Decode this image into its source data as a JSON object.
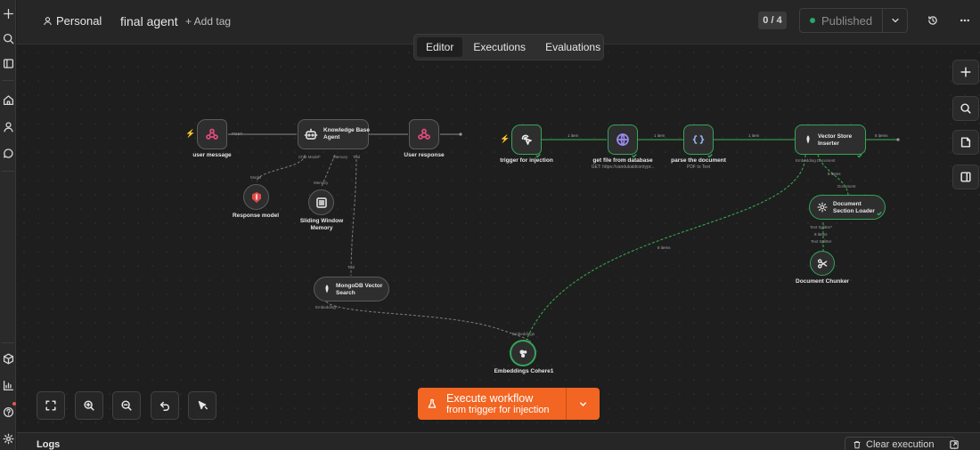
{
  "header": {
    "project_label": "Personal",
    "workflow_name": "final agent",
    "add_tag_label": "+ Add tag",
    "counter": "0 / 4",
    "status_label": "Published",
    "status_color": "#2aa765"
  },
  "tabs": [
    {
      "label": "Editor",
      "active": true
    },
    {
      "label": "Executions",
      "active": false
    },
    {
      "label": "Evaluations",
      "active": false
    }
  ],
  "nodes": {
    "user_message": {
      "label": "user message"
    },
    "kb_agent": {
      "label_line1": "Knowledge Base",
      "label_line2": "Agent"
    },
    "user_response": {
      "label": "User response"
    },
    "response_model": {
      "label": "Response model"
    },
    "sliding_memory": {
      "label_line1": "Sliding Window",
      "label_line2": "Memory"
    },
    "mongodb_search": {
      "label_line1": "MongoDB Vector",
      "label_line2": "Search"
    },
    "trigger_injection": {
      "label": "trigger for injection"
    },
    "get_file": {
      "label": "get file from database",
      "sub": "GET: https://vandukaidcontypr..."
    },
    "parse_doc": {
      "label": "parse the document",
      "sub": "PDF to Text"
    },
    "vector_store": {
      "label_line1": "Vector Store",
      "label_line2": "Inserter"
    },
    "doc_loader": {
      "label_line1": "Document",
      "label_line2": "Section Loader"
    },
    "doc_chunker": {
      "label": "Document Chunker"
    },
    "embeddings": {
      "label": "Embeddings Cohere1"
    }
  },
  "port_labels": {
    "post": "POST",
    "chat_model": "Chat Model*",
    "memory": "Memory",
    "tool": "Tool",
    "model": "Model",
    "memory2": "Memory",
    "tool2": "Tool",
    "embedding": "Embedding*",
    "embeddings_in": "Embeddings",
    "embedding_vs": "Embedding Document",
    "document": "Document",
    "text_splitter": "Text Splitter*",
    "text_splitter2": "Text Splitter"
  },
  "edge_labels": {
    "e1": "1 item",
    "e2": "1 item",
    "e3": "1 item",
    "e4": "8 items",
    "e5": "8 items",
    "e6": "8 items",
    "e7": "8 items"
  },
  "execute": {
    "title": "Execute workflow",
    "subtitle": "from trigger for injection",
    "color": "#f26522"
  },
  "logs": {
    "title": "Logs",
    "clear_label": "Clear execution"
  }
}
